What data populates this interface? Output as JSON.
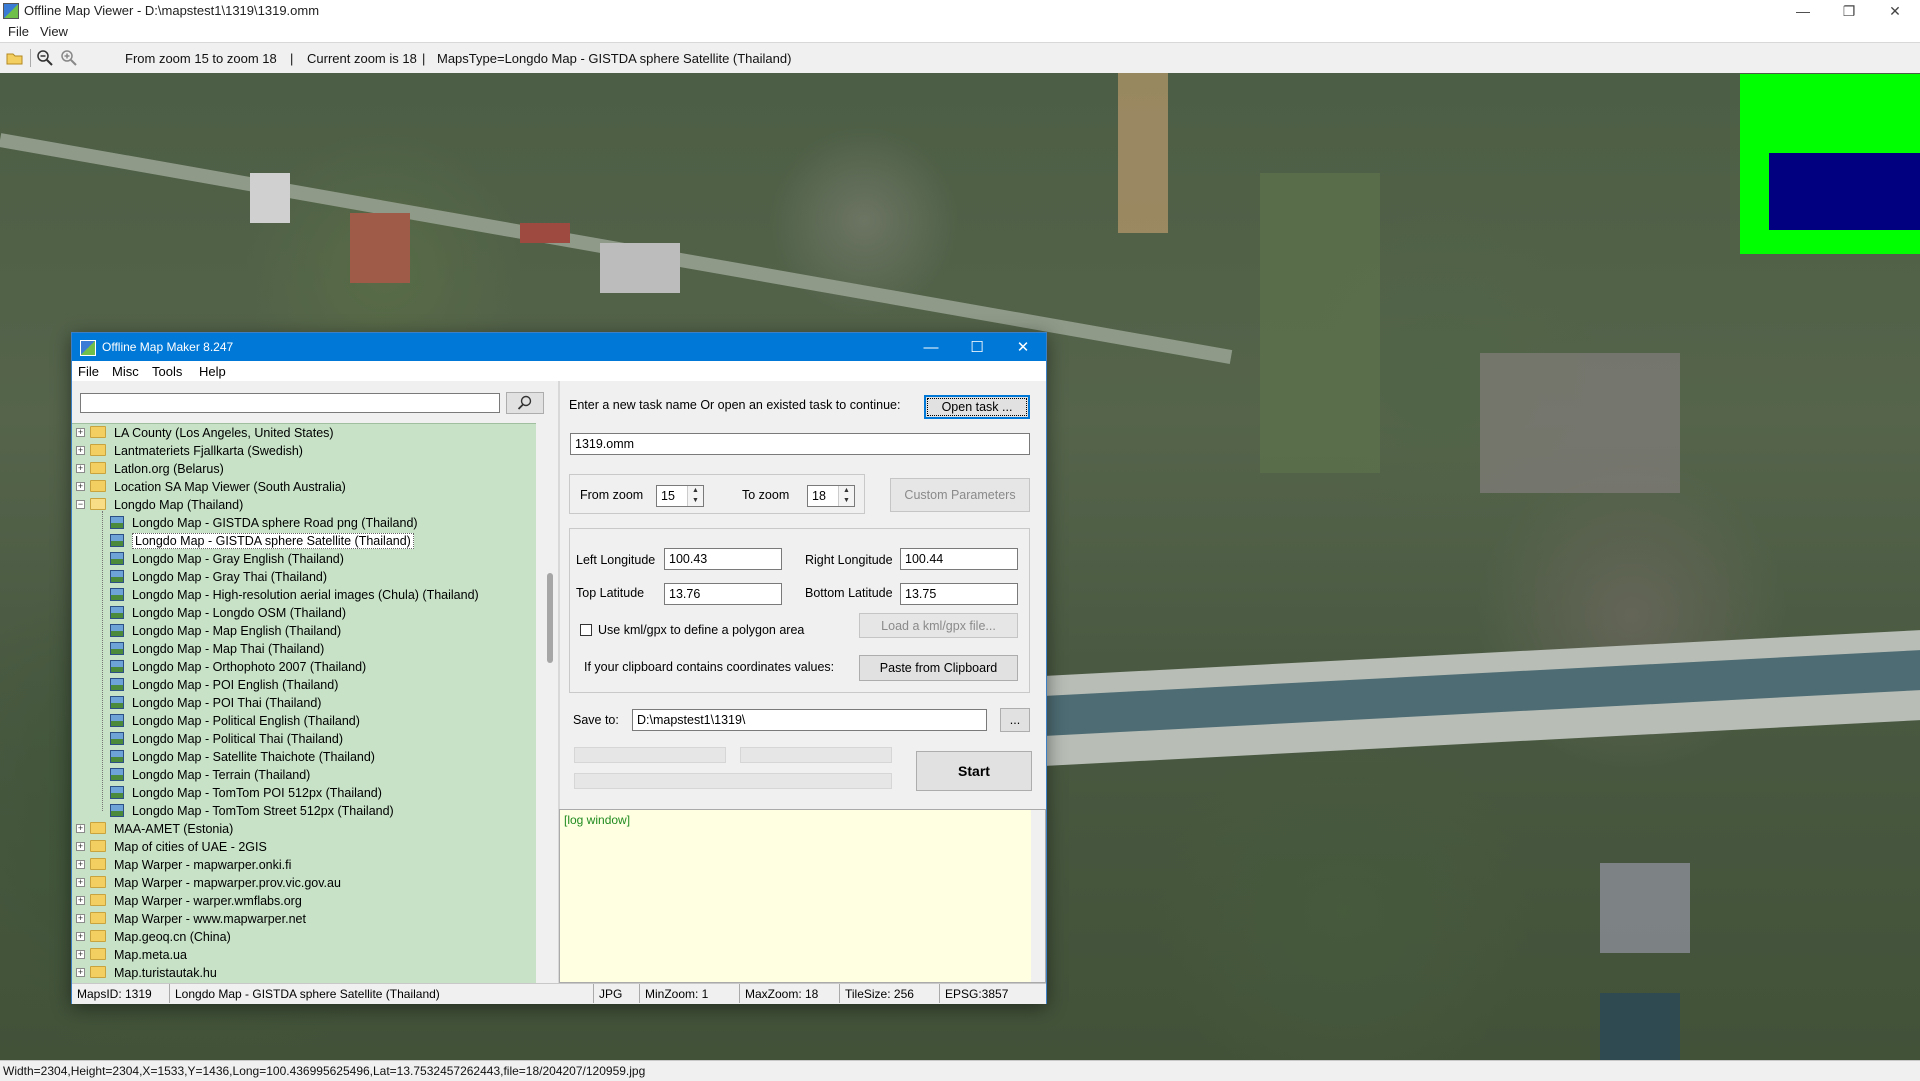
{
  "viewer": {
    "title": "Offline Map Viewer - D:\\mapstest1\\1319\\1319.omm",
    "menu": [
      "File",
      "View"
    ],
    "toolbar": {
      "zoom_range": "From zoom 15 to zoom 18",
      "current_zoom": "Current zoom is 18",
      "maps_type": "MapsType=Longdo Map - GISTDA sphere Satellite (Thailand)",
      "separator": "|"
    },
    "status": "Width=2304,Height=2304,X=1533,Y=1436,Long=100.436995625496,Lat=13.7532457262443,file=18/204207/120959.jpg",
    "overview_colors": {
      "frame": "#00ff00",
      "viewport": "#000080"
    }
  },
  "maker": {
    "title": "Offline Map Maker 8.247",
    "menu": [
      "File",
      "Misc",
      "Tools",
      "Help"
    ],
    "search": {
      "value": "",
      "placeholder": ""
    },
    "tree": {
      "items": [
        {
          "label": "LA County (Los Angeles, United States)",
          "level": 0,
          "type": "folder"
        },
        {
          "label": "Lantmateriets Fjallkarta (Swedish)",
          "level": 0,
          "type": "folder"
        },
        {
          "label": "Latlon.org (Belarus)",
          "level": 0,
          "type": "folder"
        },
        {
          "label": "Location SA Map Viewer (South Australia)",
          "level": 0,
          "type": "folder"
        },
        {
          "label": "Longdo Map (Thailand)",
          "level": 0,
          "type": "folder-open"
        },
        {
          "label": "Longdo Map - GISTDA sphere Road png (Thailand)",
          "level": 1,
          "type": "map"
        },
        {
          "label": "Longdo Map - GISTDA sphere Satellite (Thailand)",
          "level": 1,
          "type": "map",
          "selected": true
        },
        {
          "label": "Longdo Map - Gray English (Thailand)",
          "level": 1,
          "type": "map"
        },
        {
          "label": "Longdo Map - Gray Thai (Thailand)",
          "level": 1,
          "type": "map"
        },
        {
          "label": "Longdo Map - High-resolution aerial images (Chula) (Thailand)",
          "level": 1,
          "type": "map"
        },
        {
          "label": "Longdo Map - Longdo OSM (Thailand)",
          "level": 1,
          "type": "map"
        },
        {
          "label": "Longdo Map - Map English (Thailand)",
          "level": 1,
          "type": "map"
        },
        {
          "label": "Longdo Map - Map Thai (Thailand)",
          "level": 1,
          "type": "map"
        },
        {
          "label": "Longdo Map - Orthophoto 2007 (Thailand)",
          "level": 1,
          "type": "map"
        },
        {
          "label": "Longdo Map - POI English (Thailand)",
          "level": 1,
          "type": "map"
        },
        {
          "label": "Longdo Map - POI Thai (Thailand)",
          "level": 1,
          "type": "map"
        },
        {
          "label": "Longdo Map - Political English (Thailand)",
          "level": 1,
          "type": "map"
        },
        {
          "label": "Longdo Map - Political Thai (Thailand)",
          "level": 1,
          "type": "map"
        },
        {
          "label": "Longdo Map - Satellite Thaichote (Thailand)",
          "level": 1,
          "type": "map"
        },
        {
          "label": "Longdo Map - Terrain (Thailand)",
          "level": 1,
          "type": "map"
        },
        {
          "label": "Longdo Map - TomTom POI 512px (Thailand)",
          "level": 1,
          "type": "map"
        },
        {
          "label": "Longdo Map - TomTom Street 512px (Thailand)",
          "level": 1,
          "type": "map"
        },
        {
          "label": "MAA-AMET (Estonia)",
          "level": 0,
          "type": "folder"
        },
        {
          "label": "Map of cities of UAE - 2GIS",
          "level": 0,
          "type": "folder"
        },
        {
          "label": "Map Warper - mapwarper.onki.fi",
          "level": 0,
          "type": "folder"
        },
        {
          "label": "Map Warper - mapwarper.prov.vic.gov.au",
          "level": 0,
          "type": "folder"
        },
        {
          "label": "Map Warper - warper.wmflabs.org",
          "level": 0,
          "type": "folder"
        },
        {
          "label": "Map Warper - www.mapwarper.net",
          "level": 0,
          "type": "folder"
        },
        {
          "label": "Map.geoq.cn (China)",
          "level": 0,
          "type": "folder"
        },
        {
          "label": "Map.meta.ua",
          "level": 0,
          "type": "folder"
        },
        {
          "label": "Map.turistautak.hu",
          "level": 0,
          "type": "folder"
        }
      ]
    },
    "task": {
      "prompt": "Enter a new task name Or open an existed task to continue:",
      "open_button": "Open task ...",
      "name": "1319.omm"
    },
    "zoom": {
      "from_label": "From zoom",
      "from_value": "15",
      "to_label": "To zoom",
      "to_value": "18",
      "custom_button": "Custom Parameters"
    },
    "bounds": {
      "left_label": "Left Longitude",
      "left_value": "100.43",
      "right_label": "Right Longitude",
      "right_value": "100.44",
      "top_label": "Top Latitude",
      "top_value": "13.76",
      "bottom_label": "Bottom Latitude",
      "bottom_value": "13.75",
      "kml_label": "Use kml/gpx to define a polygon area",
      "kml_checked": false,
      "load_kml_button": "Load a kml/gpx file...",
      "clipboard_label": "If your clipboard contains coordinates values:",
      "paste_button": "Paste from Clipboard"
    },
    "save": {
      "label": "Save to:",
      "path": "D:\\mapstest1\\1319\\",
      "browse_button": "...",
      "start_button": "Start"
    },
    "log": {
      "text": "[log window]"
    },
    "status": {
      "maps_id": "MapsID: 1319",
      "maps_name": "Longdo Map - GISTDA sphere Satellite (Thailand)",
      "format": "JPG",
      "min_zoom": "MinZoom: 1",
      "max_zoom": "MaxZoom: 18",
      "tile_size": "TileSize: 256",
      "epsg": "EPSG:3857"
    }
  }
}
